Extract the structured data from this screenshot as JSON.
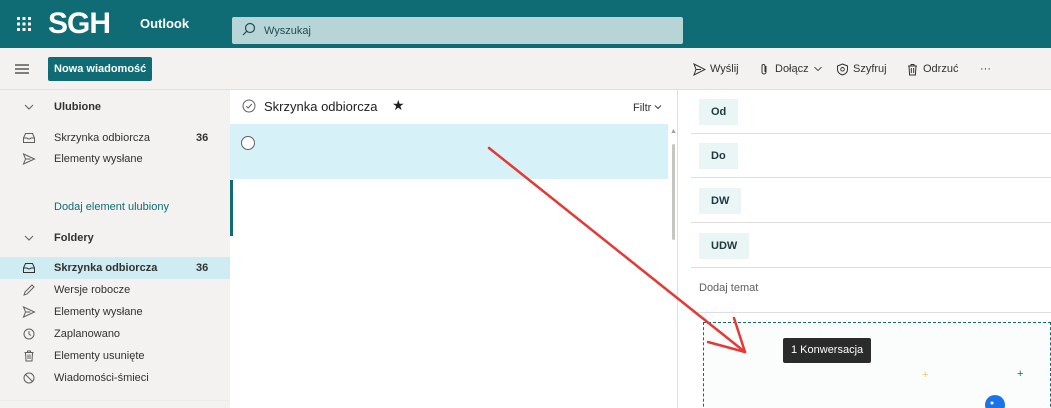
{
  "topbar": {
    "logo": "SGH",
    "app_name": "Outlook",
    "search_placeholder": "Wyszukaj"
  },
  "commandbar": {
    "new_message": "Nowa wiadomość",
    "send": "Wyślij",
    "attach": "Dołącz",
    "encrypt": "Szyfruj",
    "discard": "Odrzuć",
    "more": "···"
  },
  "nav": {
    "favorites_header": "Ulubione",
    "favorites": [
      {
        "label": "Skrzynka odbiorcza",
        "count": "36",
        "icon": "inbox-icon"
      },
      {
        "label": "Elementy wysłane",
        "count": "",
        "icon": "send-icon"
      }
    ],
    "add_favorite": "Dodaj element ulubiony",
    "folders_header": "Foldery",
    "folders": [
      {
        "label": "Skrzynka odbiorcza",
        "count": "36",
        "icon": "inbox-icon"
      },
      {
        "label": "Wersje robocze",
        "count": "",
        "icon": "pencil-icon"
      },
      {
        "label": "Elementy wysłane",
        "count": "",
        "icon": "send-icon"
      },
      {
        "label": "Zaplanowano",
        "count": "",
        "icon": "clock-icon"
      },
      {
        "label": "Elementy usunięte",
        "count": "",
        "icon": "trash-icon"
      },
      {
        "label": "Wiadomości-śmieci",
        "count": "",
        "icon": "block-icon"
      }
    ]
  },
  "list": {
    "title": "Skrzynka odbiorcza",
    "star": "★",
    "filter": "Filtr"
  },
  "compose": {
    "from": "Od",
    "to": "Do",
    "cc": "DW",
    "bcc": "UDW",
    "subject_placeholder": "Dodaj temat"
  },
  "tooltip": "1 Konwersacja",
  "colors": {
    "brand": "#0f6c74",
    "selected_row": "#d6f1f7",
    "active_nav": "#cfecf2",
    "annotation_arrow": "#e53935"
  }
}
